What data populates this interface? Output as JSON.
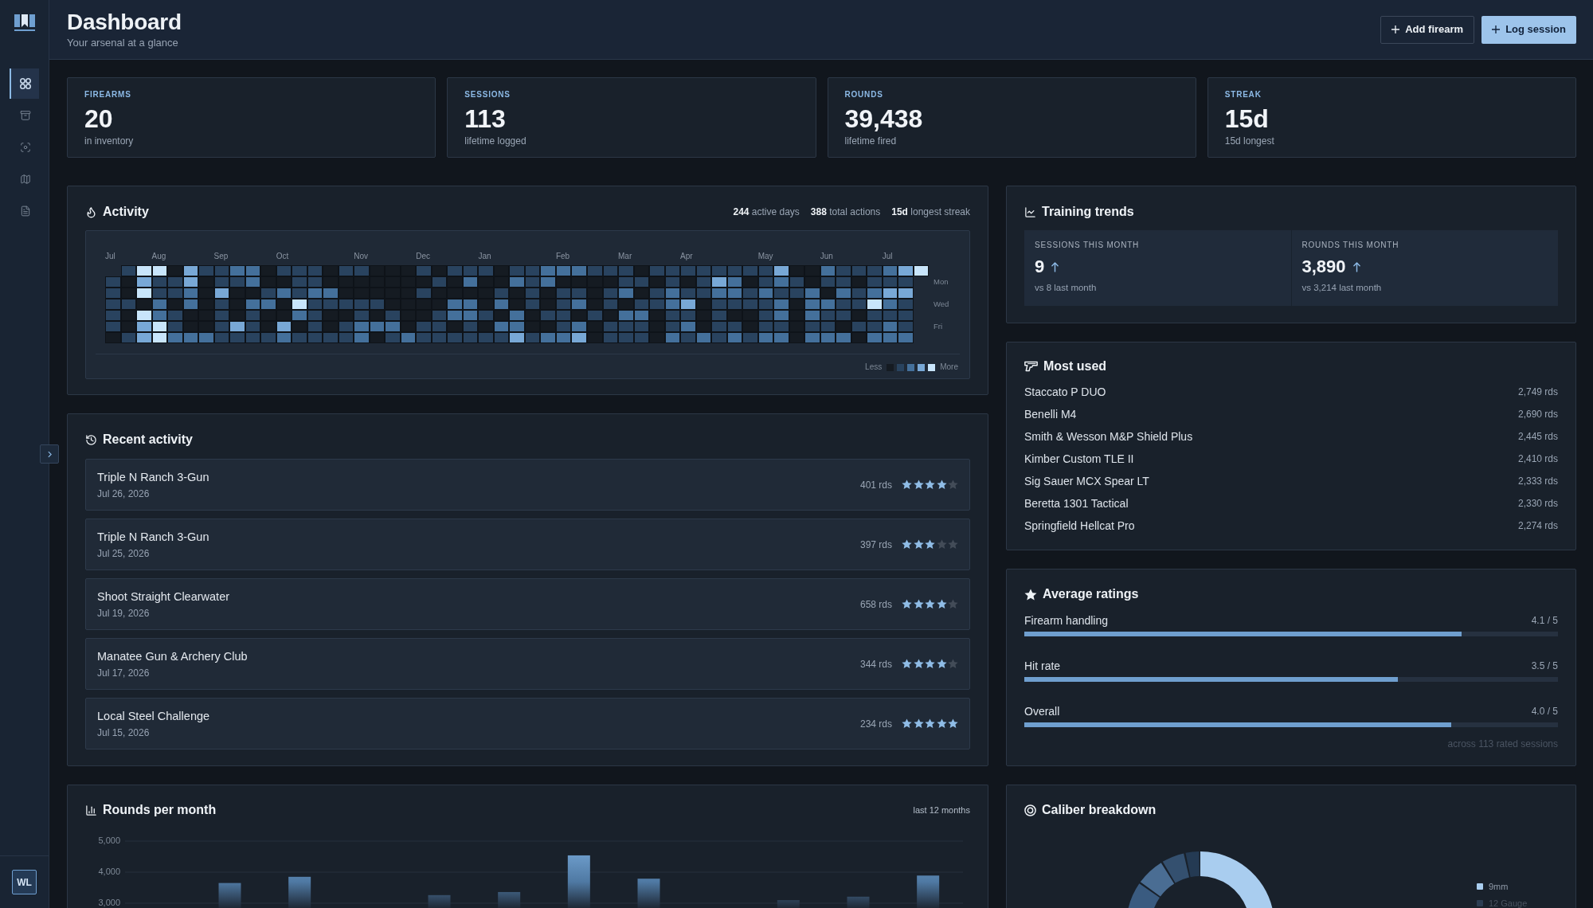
{
  "header": {
    "title": "Dashboard",
    "subtitle": "Your arsenal at a glance",
    "actions": [
      {
        "label": "Add firearm",
        "kind": "outline"
      },
      {
        "label": "Log session",
        "kind": "primary"
      }
    ]
  },
  "sidebar": {
    "items": [
      {
        "selected": true
      },
      {
        "selected": false
      },
      {
        "selected": false
      },
      {
        "selected": false
      },
      {
        "selected": false
      }
    ],
    "user": {
      "initials": "WL"
    }
  },
  "stats": [
    {
      "label": "FIREARMS",
      "value": "20",
      "caption": "in inventory"
    },
    {
      "label": "SESSIONS",
      "value": "113",
      "caption": "lifetime logged"
    },
    {
      "label": "ROUNDS",
      "value": "39,438",
      "caption": "lifetime fired"
    },
    {
      "label": "STREAK",
      "value": "15d",
      "caption": "15d longest"
    }
  ],
  "activity": {
    "title": "Activity",
    "summary": [
      "**244** active days",
      "**388** total actions",
      "**15d** longest streak"
    ],
    "day_labels": [
      "Mon",
      "Wed",
      "Fri"
    ],
    "legend": {
      "low": "Less",
      "high": "More"
    },
    "weeks": [
      {
        "month": "Jul",
        "days": [
          {
            "color": "#29435f"
          },
          {
            "color": "#29435f"
          },
          {
            "color": "#29435f"
          },
          {
            "color": "#29435f"
          },
          {
            "color": "#29435f"
          },
          {
            "color": "#151b22"
          }
        ]
      },
      {
        "days": [
          {
            "color": "#29435f"
          },
          {
            "color": "#151b22"
          },
          {
            "color": "#151b22"
          },
          {
            "color": "#29435f"
          },
          {
            "color": "#151b22"
          },
          {
            "color": "#151b22"
          },
          {
            "color": "#29435f"
          }
        ]
      },
      {
        "days": [
          {
            "color": "#c8e5fb"
          },
          {
            "color": "#78a8d6"
          },
          {
            "color": "#c8e5fb"
          },
          {
            "color": "#151b22"
          },
          {
            "color": "#c8e5fb"
          },
          {
            "color": "#78a8d6"
          },
          {
            "color": "#78a8d6"
          }
        ]
      },
      {
        "month": "Aug",
        "days": [
          {
            "color": "#c8e5fb"
          },
          {
            "color": "#29435f"
          },
          {
            "color": "#29435f"
          },
          {
            "color": "#44709b"
          },
          {
            "color": "#44709b"
          },
          {
            "color": "#c8e5fb"
          },
          {
            "color": "#c8e5fb"
          }
        ]
      },
      {
        "days": [
          {
            "color": "#151b22"
          },
          {
            "color": "#29435f"
          },
          {
            "color": "#29435f"
          },
          {
            "color": "#151b22"
          },
          {
            "color": "#29435f"
          },
          {
            "color": "#29435f"
          },
          {
            "color": "#44709b"
          }
        ]
      },
      {
        "days": [
          {
            "color": "#78a8d6"
          },
          {
            "color": "#78a8d6"
          },
          {
            "color": "#44709b"
          },
          {
            "color": "#44709b"
          },
          {
            "color": "#151b22"
          },
          {
            "color": "#151b22"
          },
          {
            "color": "#44709b"
          }
        ]
      },
      {
        "days": [
          {
            "color": "#29435f"
          },
          {
            "color": "#151b22"
          },
          {
            "color": "#151b22"
          },
          {
            "color": "#151b22"
          },
          {
            "color": "#151b22"
          },
          {
            "color": "#151b22"
          },
          {
            "color": "#44709b"
          }
        ]
      },
      {
        "month": "Sep",
        "days": [
          {
            "color": "#29435f"
          },
          {
            "color": "#29435f"
          },
          {
            "color": "#78a8d6"
          },
          {
            "color": "#29435f"
          },
          {
            "color": "#29435f"
          },
          {
            "color": "#29435f"
          },
          {
            "color": "#29435f"
          }
        ]
      },
      {
        "days": [
          {
            "color": "#44709b"
          },
          {
            "color": "#29435f"
          },
          {
            "color": "#151b22"
          },
          {
            "color": "#151b22"
          },
          {
            "color": "#151b22"
          },
          {
            "color": "#78a8d6"
          },
          {
            "color": "#29435f"
          }
        ]
      },
      {
        "days": [
          {
            "color": "#44709b"
          },
          {
            "color": "#44709b"
          },
          {
            "color": "#151b22"
          },
          {
            "color": "#44709b"
          },
          {
            "color": "#29435f"
          },
          {
            "color": "#29435f"
          },
          {
            "color": "#29435f"
          }
        ]
      },
      {
        "days": [
          {
            "color": "#151b22"
          },
          {
            "color": "#151b22"
          },
          {
            "color": "#29435f"
          },
          {
            "color": "#44709b"
          },
          {
            "color": "#151b22"
          },
          {
            "color": "#151b22"
          },
          {
            "color": "#29435f"
          }
        ]
      },
      {
        "month": "Oct",
        "days": [
          {
            "color": "#29435f"
          },
          {
            "color": "#151b22"
          },
          {
            "color": "#44709b"
          },
          {
            "color": "#151b22"
          },
          {
            "color": "#151b22"
          },
          {
            "color": "#78a8d6"
          },
          {
            "color": "#44709b"
          }
        ]
      },
      {
        "days": [
          {
            "color": "#29435f"
          },
          {
            "color": "#29435f"
          },
          {
            "color": "#29435f"
          },
          {
            "color": "#c8e5fb"
          },
          {
            "color": "#44709b"
          },
          {
            "color": "#151b22"
          },
          {
            "color": "#29435f"
          }
        ]
      },
      {
        "days": [
          {
            "color": "#29435f"
          },
          {
            "color": "#29435f"
          },
          {
            "color": "#44709b"
          },
          {
            "color": "#29435f"
          },
          {
            "color": "#29435f"
          },
          {
            "color": "#29435f"
          },
          {
            "color": "#29435f"
          }
        ]
      },
      {
        "days": [
          {
            "color": "#151b22"
          },
          {
            "color": "#151b22"
          },
          {
            "color": "#44709b"
          },
          {
            "color": "#29435f"
          },
          {
            "color": "#151b22"
          },
          {
            "color": "#151b22"
          },
          {
            "color": "#29435f"
          }
        ]
      },
      {
        "days": [
          {
            "color": "#29435f"
          },
          {
            "color": "#151b22"
          },
          {
            "color": "#151b22"
          },
          {
            "color": "#29435f"
          },
          {
            "color": "#151b22"
          },
          {
            "color": "#29435f"
          },
          {
            "color": "#29435f"
          }
        ]
      },
      {
        "month": "Nov",
        "days": [
          {
            "color": "#29435f"
          },
          {
            "color": "#151b22"
          },
          {
            "color": "#151b22"
          },
          {
            "color": "#29435f"
          },
          {
            "color": "#29435f"
          },
          {
            "color": "#44709b"
          },
          {
            "color": "#44709b"
          }
        ]
      },
      {
        "days": [
          {
            "color": "#151b22"
          },
          {
            "color": "#151b22"
          },
          {
            "color": "#151b22"
          },
          {
            "color": "#29435f"
          },
          {
            "color": "#151b22"
          },
          {
            "color": "#44709b"
          },
          {
            "color": "#151b22"
          }
        ]
      },
      {
        "days": [
          {
            "color": "#151b22"
          },
          {
            "color": "#151b22"
          },
          {
            "color": "#151b22"
          },
          {
            "color": "#151b22"
          },
          {
            "color": "#29435f"
          },
          {
            "color": "#44709b"
          },
          {
            "color": "#29435f"
          }
        ]
      },
      {
        "days": [
          {
            "color": "#151b22"
          },
          {
            "color": "#151b22"
          },
          {
            "color": "#151b22"
          },
          {
            "color": "#151b22"
          },
          {
            "color": "#151b22"
          },
          {
            "color": "#151b22"
          },
          {
            "color": "#44709b"
          }
        ]
      },
      {
        "month": "Dec",
        "days": [
          {
            "color": "#29435f"
          },
          {
            "color": "#151b22"
          },
          {
            "color": "#29435f"
          },
          {
            "color": "#151b22"
          },
          {
            "color": "#151b22"
          },
          {
            "color": "#29435f"
          },
          {
            "color": "#29435f"
          }
        ]
      },
      {
        "days": [
          {
            "color": "#151b22"
          },
          {
            "color": "#29435f"
          },
          {
            "color": "#151b22"
          },
          {
            "color": "#151b22"
          },
          {
            "color": "#29435f"
          },
          {
            "color": "#29435f"
          },
          {
            "color": "#29435f"
          }
        ]
      },
      {
        "days": [
          {
            "color": "#29435f"
          },
          {
            "color": "#151b22"
          },
          {
            "color": "#151b22"
          },
          {
            "color": "#44709b"
          },
          {
            "color": "#44709b"
          },
          {
            "color": "#151b22"
          },
          {
            "color": "#29435f"
          }
        ]
      },
      {
        "days": [
          {
            "color": "#29435f"
          },
          {
            "color": "#44709b"
          },
          {
            "color": "#151b22"
          },
          {
            "color": "#44709b"
          },
          {
            "color": "#44709b"
          },
          {
            "color": "#29435f"
          },
          {
            "color": "#29435f"
          }
        ]
      },
      {
        "month": "Jan",
        "days": [
          {
            "color": "#29435f"
          },
          {
            "color": "#151b22"
          },
          {
            "color": "#151b22"
          },
          {
            "color": "#151b22"
          },
          {
            "color": "#29435f"
          },
          {
            "color": "#151b22"
          },
          {
            "color": "#29435f"
          }
        ]
      },
      {
        "days": [
          {
            "color": "#151b22"
          },
          {
            "color": "#151b22"
          },
          {
            "color": "#29435f"
          },
          {
            "color": "#44709b"
          },
          {
            "color": "#151b22"
          },
          {
            "color": "#44709b"
          },
          {
            "color": "#29435f"
          }
        ]
      },
      {
        "days": [
          {
            "color": "#29435f"
          },
          {
            "color": "#44709b"
          },
          {
            "color": "#151b22"
          },
          {
            "color": "#151b22"
          },
          {
            "color": "#44709b"
          },
          {
            "color": "#44709b"
          },
          {
            "color": "#78a8d6"
          }
        ]
      },
      {
        "days": [
          {
            "color": "#29435f"
          },
          {
            "color": "#29435f"
          },
          {
            "color": "#29435f"
          },
          {
            "color": "#29435f"
          },
          {
            "color": "#151b22"
          },
          {
            "color": "#151b22"
          },
          {
            "color": "#29435f"
          }
        ]
      },
      {
        "days": [
          {
            "color": "#44709b"
          },
          {
            "color": "#44709b"
          },
          {
            "color": "#151b22"
          },
          {
            "color": "#151b22"
          },
          {
            "color": "#29435f"
          },
          {
            "color": "#151b22"
          },
          {
            "color": "#44709b"
          }
        ]
      },
      {
        "month": "Feb",
        "days": [
          {
            "color": "#44709b"
          },
          {
            "color": "#151b22"
          },
          {
            "color": "#29435f"
          },
          {
            "color": "#29435f"
          },
          {
            "color": "#29435f"
          },
          {
            "color": "#29435f"
          },
          {
            "color": "#44709b"
          }
        ]
      },
      {
        "days": [
          {
            "color": "#44709b"
          },
          {
            "color": "#151b22"
          },
          {
            "color": "#29435f"
          },
          {
            "color": "#44709b"
          },
          {
            "color": "#151b22"
          },
          {
            "color": "#44709b"
          },
          {
            "color": "#78a8d6"
          }
        ]
      },
      {
        "days": [
          {
            "color": "#29435f"
          },
          {
            "color": "#151b22"
          },
          {
            "color": "#151b22"
          },
          {
            "color": "#151b22"
          },
          {
            "color": "#29435f"
          },
          {
            "color": "#151b22"
          },
          {
            "color": "#151b22"
          }
        ]
      },
      {
        "days": [
          {
            "color": "#29435f"
          },
          {
            "color": "#151b22"
          },
          {
            "color": "#29435f"
          },
          {
            "color": "#29435f"
          },
          {
            "color": "#151b22"
          },
          {
            "color": "#29435f"
          },
          {
            "color": "#29435f"
          }
        ]
      },
      {
        "month": "Mar",
        "days": [
          {
            "color": "#29435f"
          },
          {
            "color": "#29435f"
          },
          {
            "color": "#44709b"
          },
          {
            "color": "#151b22"
          },
          {
            "color": "#44709b"
          },
          {
            "color": "#29435f"
          },
          {
            "color": "#29435f"
          }
        ]
      },
      {
        "days": [
          {
            "color": "#151b22"
          },
          {
            "color": "#29435f"
          },
          {
            "color": "#151b22"
          },
          {
            "color": "#29435f"
          },
          {
            "color": "#44709b"
          },
          {
            "color": "#29435f"
          },
          {
            "color": "#29435f"
          }
        ]
      },
      {
        "days": [
          {
            "color": "#29435f"
          },
          {
            "color": "#151b22"
          },
          {
            "color": "#29435f"
          },
          {
            "color": "#29435f"
          },
          {
            "color": "#151b22"
          },
          {
            "color": "#151b22"
          },
          {
            "color": "#151b22"
          }
        ]
      },
      {
        "days": [
          {
            "color": "#29435f"
          },
          {
            "color": "#29435f"
          },
          {
            "color": "#44709b"
          },
          {
            "color": "#44709b"
          },
          {
            "color": "#29435f"
          },
          {
            "color": "#29435f"
          },
          {
            "color": "#44709b"
          }
        ]
      },
      {
        "month": "Apr",
        "days": [
          {
            "color": "#29435f"
          },
          {
            "color": "#151b22"
          },
          {
            "color": "#29435f"
          },
          {
            "color": "#78a8d6"
          },
          {
            "color": "#29435f"
          },
          {
            "color": "#44709b"
          },
          {
            "color": "#29435f"
          }
        ]
      },
      {
        "days": [
          {
            "color": "#29435f"
          },
          {
            "color": "#29435f"
          },
          {
            "color": "#29435f"
          },
          {
            "color": "#151b22"
          },
          {
            "color": "#151b22"
          },
          {
            "color": "#151b22"
          },
          {
            "color": "#44709b"
          }
        ]
      },
      {
        "days": [
          {
            "color": "#29435f"
          },
          {
            "color": "#78a8d6"
          },
          {
            "color": "#44709b"
          },
          {
            "color": "#29435f"
          },
          {
            "color": "#29435f"
          },
          {
            "color": "#29435f"
          },
          {
            "color": "#29435f"
          }
        ]
      },
      {
        "days": [
          {
            "color": "#29435f"
          },
          {
            "color": "#44709b"
          },
          {
            "color": "#44709b"
          },
          {
            "color": "#29435f"
          },
          {
            "color": "#151b22"
          },
          {
            "color": "#29435f"
          },
          {
            "color": "#44709b"
          }
        ]
      },
      {
        "days": [
          {
            "color": "#29435f"
          },
          {
            "color": "#151b22"
          },
          {
            "color": "#29435f"
          },
          {
            "color": "#29435f"
          },
          {
            "color": "#151b22"
          },
          {
            "color": "#151b22"
          },
          {
            "color": "#29435f"
          }
        ]
      },
      {
        "month": "May",
        "days": [
          {
            "color": "#29435f"
          },
          {
            "color": "#29435f"
          },
          {
            "color": "#44709b"
          },
          {
            "color": "#29435f"
          },
          {
            "color": "#29435f"
          },
          {
            "color": "#29435f"
          },
          {
            "color": "#44709b"
          }
        ]
      },
      {
        "days": [
          {
            "color": "#78a8d6"
          },
          {
            "color": "#44709b"
          },
          {
            "color": "#29435f"
          },
          {
            "color": "#44709b"
          },
          {
            "color": "#44709b"
          },
          {
            "color": "#29435f"
          },
          {
            "color": "#44709b"
          }
        ]
      },
      {
        "days": [
          {
            "color": "#151b22"
          },
          {
            "color": "#29435f"
          },
          {
            "color": "#29435f"
          },
          {
            "color": "#151b22"
          },
          {
            "color": "#151b22"
          },
          {
            "color": "#151b22"
          },
          {
            "color": "#151b22"
          }
        ]
      },
      {
        "days": [
          {
            "color": "#151b22"
          },
          {
            "color": "#151b22"
          },
          {
            "color": "#44709b"
          },
          {
            "color": "#44709b"
          },
          {
            "color": "#44709b"
          },
          {
            "color": "#29435f"
          },
          {
            "color": "#44709b"
          }
        ]
      },
      {
        "month": "Jun",
        "days": [
          {
            "color": "#44709b"
          },
          {
            "color": "#29435f"
          },
          {
            "color": "#151b22"
          },
          {
            "color": "#44709b"
          },
          {
            "color": "#29435f"
          },
          {
            "color": "#29435f"
          },
          {
            "color": "#44709b"
          }
        ]
      },
      {
        "days": [
          {
            "color": "#29435f"
          },
          {
            "color": "#29435f"
          },
          {
            "color": "#44709b"
          },
          {
            "color": "#29435f"
          },
          {
            "color": "#29435f"
          },
          {
            "color": "#151b22"
          },
          {
            "color": "#44709b"
          }
        ]
      },
      {
        "days": [
          {
            "color": "#29435f"
          },
          {
            "color": "#151b22"
          },
          {
            "color": "#29435f"
          },
          {
            "color": "#29435f"
          },
          {
            "color": "#151b22"
          },
          {
            "color": "#29435f"
          },
          {
            "color": "#151b22"
          }
        ]
      },
      {
        "days": [
          {
            "color": "#29435f"
          },
          {
            "color": "#29435f"
          },
          {
            "color": "#44709b"
          },
          {
            "color": "#c8e5fb"
          },
          {
            "color": "#29435f"
          },
          {
            "color": "#29435f"
          },
          {
            "color": "#44709b"
          }
        ]
      },
      {
        "month": "Jul",
        "days": [
          {
            "color": "#44709b"
          },
          {
            "color": "#29435f"
          },
          {
            "color": "#78a8d6"
          },
          {
            "color": "#44709b"
          },
          {
            "color": "#29435f"
          },
          {
            "color": "#44709b"
          },
          {
            "color": "#44709b"
          }
        ]
      },
      {
        "days": [
          {
            "color": "#78a8d6"
          },
          {
            "color": "#29435f"
          },
          {
            "color": "#78a8d6"
          },
          {
            "color": "#29435f"
          },
          {
            "color": "#29435f"
          },
          {
            "color": "#29435f"
          },
          {
            "color": "#44709b"
          }
        ]
      },
      {
        "days": [
          {
            "color": "#c8e5fb"
          }
        ]
      }
    ]
  },
  "training": {
    "title": "Training trends",
    "metrics": [
      {
        "label": "SESSIONS THIS MONTH",
        "value": "9",
        "rising": true,
        "caption": "vs 8 last month"
      },
      {
        "label": "ROUNDS THIS MONTH",
        "value": "3,890",
        "rising": true,
        "caption": "vs 3,214 last month"
      }
    ]
  },
  "most_used": {
    "title": "Most used",
    "items": [
      {
        "name": "Staccato P DUO",
        "rounds": "2,749 rds"
      },
      {
        "name": "Benelli M4",
        "rounds": "2,690 rds"
      },
      {
        "name": "Smith & Wesson M&P Shield Plus",
        "rounds": "2,445 rds"
      },
      {
        "name": "Kimber Custom TLE II",
        "rounds": "2,410 rds"
      },
      {
        "name": "Sig Sauer MCX Spear LT",
        "rounds": "2,333 rds"
      },
      {
        "name": "Beretta 1301 Tactical",
        "rounds": "2,330 rds"
      },
      {
        "name": "Springfield Hellcat Pro",
        "rounds": "2,274 rds"
      }
    ]
  },
  "recent": {
    "title": "Recent activity",
    "items": [
      {
        "title": "Triple N Ranch 3-Gun",
        "date": "Jul 26, 2026",
        "rounds": "401 rds",
        "stars": 4
      },
      {
        "title": "Triple N Ranch 3-Gun",
        "date": "Jul 25, 2026",
        "rounds": "397 rds",
        "stars": 3
      },
      {
        "title": "Shoot Straight Clearwater",
        "date": "Jul 19, 2026",
        "rounds": "658 rds",
        "stars": 4
      },
      {
        "title": "Manatee Gun & Archery Club",
        "date": "Jul 17, 2026",
        "rounds": "344 rds",
        "stars": 4
      },
      {
        "title": "Local Steel Challenge",
        "date": "Jul 15, 2026",
        "rounds": "234 rds",
        "stars": 5
      }
    ]
  },
  "ratings": {
    "title": "Average ratings",
    "items": [
      {
        "label": "Firearm handling",
        "score": "4.1 / 5",
        "level": 0.82
      },
      {
        "label": "Hit rate",
        "score": "3.5 / 5",
        "level": 0.7
      },
      {
        "label": "Overall",
        "score": "4.0 / 5",
        "level": 0.8
      }
    ],
    "footer": "across 113 rated sessions"
  },
  "rounds_per_month": {
    "title": "Rounds per month",
    "range": "last 12 months",
    "chart_data": {
      "type": "bar",
      "values": [
        null,
        3650,
        3850,
        null,
        3260,
        3360,
        4540,
        3790,
        null,
        3100,
        3210,
        3890
      ],
      "ylim": [
        2820,
        5000
      ],
      "yticks": [
        {
          "value": 5000,
          "label": "5,000"
        },
        {
          "value": 4000,
          "label": "4,000"
        },
        {
          "value": 3000,
          "label": "3,000"
        }
      ],
      "grid": true
    }
  },
  "calibers": {
    "title": "Caliber breakdown",
    "legend": [
      {
        "label": "9mm",
        "color": "#a9cdef"
      },
      {
        "label": "12 Gauge",
        "color": "#2c3d52"
      }
    ]
  }
}
